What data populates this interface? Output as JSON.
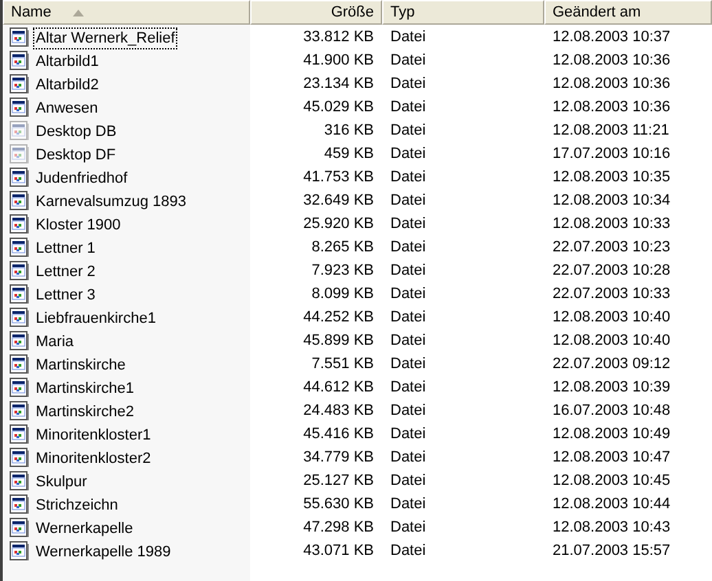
{
  "columns": [
    {
      "label": "Name",
      "sorted": true
    },
    {
      "label": "Größe",
      "sorted": false
    },
    {
      "label": "Typ",
      "sorted": false
    },
    {
      "label": "Geändert am",
      "sorted": false
    }
  ],
  "rows": [
    {
      "name": "Altar Wernerk_Relief",
      "size": "33.812 KB",
      "type": "Datei",
      "modified": "12.08.2003 10:37",
      "hidden": false,
      "focused": true
    },
    {
      "name": "Altarbild1",
      "size": "41.900 KB",
      "type": "Datei",
      "modified": "12.08.2003 10:36",
      "hidden": false,
      "focused": false
    },
    {
      "name": "Altarbild2",
      "size": "23.134 KB",
      "type": "Datei",
      "modified": "12.08.2003 10:36",
      "hidden": false,
      "focused": false
    },
    {
      "name": "Anwesen",
      "size": "45.029 KB",
      "type": "Datei",
      "modified": "12.08.2003 10:36",
      "hidden": false,
      "focused": false
    },
    {
      "name": "Desktop DB",
      "size": "316 KB",
      "type": "Datei",
      "modified": "12.08.2003 11:21",
      "hidden": true,
      "focused": false
    },
    {
      "name": "Desktop DF",
      "size": "459 KB",
      "type": "Datei",
      "modified": "17.07.2003 10:16",
      "hidden": true,
      "focused": false
    },
    {
      "name": "Judenfriedhof",
      "size": "41.753 KB",
      "type": "Datei",
      "modified": "12.08.2003 10:35",
      "hidden": false,
      "focused": false
    },
    {
      "name": "Karnevalsumzug 1893",
      "size": "32.649 KB",
      "type": "Datei",
      "modified": "12.08.2003 10:34",
      "hidden": false,
      "focused": false
    },
    {
      "name": "Kloster 1900",
      "size": "25.920 KB",
      "type": "Datei",
      "modified": "12.08.2003 10:33",
      "hidden": false,
      "focused": false
    },
    {
      "name": "Lettner 1",
      "size": "8.265 KB",
      "type": "Datei",
      "modified": "22.07.2003 10:23",
      "hidden": false,
      "focused": false
    },
    {
      "name": "Lettner 2",
      "size": "7.923 KB",
      "type": "Datei",
      "modified": "22.07.2003 10:28",
      "hidden": false,
      "focused": false
    },
    {
      "name": "Lettner 3",
      "size": "8.099 KB",
      "type": "Datei",
      "modified": "22.07.2003 10:33",
      "hidden": false,
      "focused": false
    },
    {
      "name": "Liebfrauenkirche1",
      "size": "44.252 KB",
      "type": "Datei",
      "modified": "12.08.2003 10:40",
      "hidden": false,
      "focused": false
    },
    {
      "name": "Maria",
      "size": "45.899 KB",
      "type": "Datei",
      "modified": "12.08.2003 10:40",
      "hidden": false,
      "focused": false
    },
    {
      "name": "Martinskirche",
      "size": "7.551 KB",
      "type": "Datei",
      "modified": "22.07.2003 09:12",
      "hidden": false,
      "focused": false
    },
    {
      "name": "Martinskirche1",
      "size": "44.612 KB",
      "type": "Datei",
      "modified": "12.08.2003 10:39",
      "hidden": false,
      "focused": false
    },
    {
      "name": "Martinskirche2",
      "size": "24.483 KB",
      "type": "Datei",
      "modified": "16.07.2003 10:48",
      "hidden": false,
      "focused": false
    },
    {
      "name": "Minoritenkloster1",
      "size": "45.416 KB",
      "type": "Datei",
      "modified": "12.08.2003 10:49",
      "hidden": false,
      "focused": false
    },
    {
      "name": "Minoritenkloster2",
      "size": "34.779 KB",
      "type": "Datei",
      "modified": "12.08.2003 10:47",
      "hidden": false,
      "focused": false
    },
    {
      "name": "Skulpur",
      "size": "25.127 KB",
      "type": "Datei",
      "modified": "12.08.2003 10:45",
      "hidden": false,
      "focused": false
    },
    {
      "name": "Strichzeichn",
      "size": "55.630 KB",
      "type": "Datei",
      "modified": "12.08.2003 10:44",
      "hidden": false,
      "focused": false
    },
    {
      "name": "Wernerkapelle",
      "size": "47.298 KB",
      "type": "Datei",
      "modified": "12.08.2003 10:43",
      "hidden": false,
      "focused": false
    },
    {
      "name": "Wernerkapelle 1989",
      "size": "43.071 KB",
      "type": "Datei",
      "modified": "21.07.2003 15:57",
      "hidden": false,
      "focused": false
    }
  ]
}
